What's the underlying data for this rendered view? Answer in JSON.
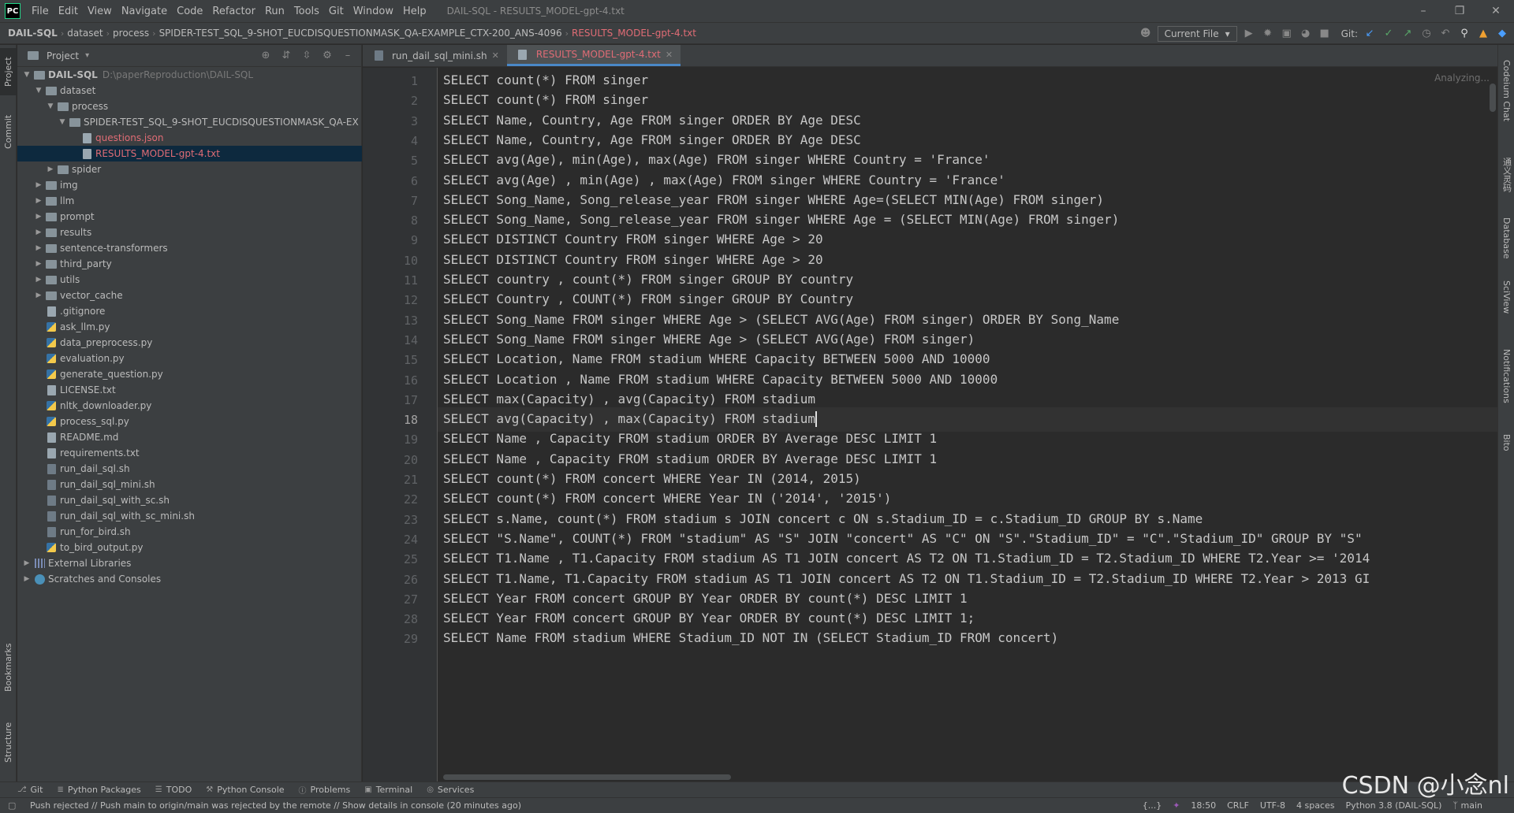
{
  "app": {
    "logo": "PC",
    "window_title": "DAIL-SQL - RESULTS_MODEL-gpt-4.txt",
    "menu": [
      "File",
      "Edit",
      "View",
      "Navigate",
      "Code",
      "Refactor",
      "Run",
      "Tools",
      "Git",
      "Window",
      "Help"
    ]
  },
  "navbar": {
    "breadcrumbs": [
      "DAIL-SQL",
      "dataset",
      "process",
      "SPIDER-TEST_SQL_9-SHOT_EUCDISQUESTIONMASK_QA-EXAMPLE_CTX-200_ANS-4096",
      "RESULTS_MODEL-gpt-4.txt"
    ],
    "run_config": "Current File",
    "git_label": "Git:"
  },
  "left_strip": {
    "project": "Project",
    "commit": "Commit",
    "bookmarks": "Bookmarks",
    "structure": "Structure"
  },
  "right_strip": {
    "codeium": "Codeium Chat",
    "tongyi": "通义灵码",
    "database": "Database",
    "sciview": "SciView",
    "notifications": "Notifications",
    "bito": "Bito"
  },
  "project_panel": {
    "title": "Project",
    "tree": [
      {
        "depth": 0,
        "arrow": "down",
        "icon": "folder",
        "label": "DAIL-SQL",
        "extra": "D:\\paperReproduction\\DAIL-SQL",
        "bold": true
      },
      {
        "depth": 1,
        "arrow": "down",
        "icon": "folder",
        "label": "dataset"
      },
      {
        "depth": 2,
        "arrow": "down",
        "icon": "folder",
        "label": "process"
      },
      {
        "depth": 3,
        "arrow": "down",
        "icon": "folder",
        "label": "SPIDER-TEST_SQL_9-SHOT_EUCDISQUESTIONMASK_QA-EX"
      },
      {
        "depth": 4,
        "arrow": "",
        "icon": "file",
        "label": "questions.json",
        "red": true
      },
      {
        "depth": 4,
        "arrow": "",
        "icon": "file",
        "label": "RESULTS_MODEL-gpt-4.txt",
        "red": true,
        "selected": true
      },
      {
        "depth": 2,
        "arrow": "right",
        "icon": "folder",
        "label": "spider"
      },
      {
        "depth": 1,
        "arrow": "right",
        "icon": "folder",
        "label": "img"
      },
      {
        "depth": 1,
        "arrow": "right",
        "icon": "folder",
        "label": "llm"
      },
      {
        "depth": 1,
        "arrow": "right",
        "icon": "folder",
        "label": "prompt"
      },
      {
        "depth": 1,
        "arrow": "right",
        "icon": "folder",
        "label": "results"
      },
      {
        "depth": 1,
        "arrow": "right",
        "icon": "folder",
        "label": "sentence-transformers"
      },
      {
        "depth": 1,
        "arrow": "right",
        "icon": "folder",
        "label": "third_party"
      },
      {
        "depth": 1,
        "arrow": "right",
        "icon": "folder",
        "label": "utils"
      },
      {
        "depth": 1,
        "arrow": "right",
        "icon": "folder",
        "label": "vector_cache"
      },
      {
        "depth": 1,
        "arrow": "",
        "icon": "file",
        "label": ".gitignore"
      },
      {
        "depth": 1,
        "arrow": "",
        "icon": "py",
        "label": "ask_llm.py"
      },
      {
        "depth": 1,
        "arrow": "",
        "icon": "py",
        "label": "data_preprocess.py"
      },
      {
        "depth": 1,
        "arrow": "",
        "icon": "py",
        "label": "evaluation.py"
      },
      {
        "depth": 1,
        "arrow": "",
        "icon": "py",
        "label": "generate_question.py"
      },
      {
        "depth": 1,
        "arrow": "",
        "icon": "file",
        "label": "LICENSE.txt"
      },
      {
        "depth": 1,
        "arrow": "",
        "icon": "py",
        "label": "nltk_downloader.py"
      },
      {
        "depth": 1,
        "arrow": "",
        "icon": "py",
        "label": "process_sql.py"
      },
      {
        "depth": 1,
        "arrow": "",
        "icon": "file",
        "label": "README.md"
      },
      {
        "depth": 1,
        "arrow": "",
        "icon": "file",
        "label": "requirements.txt"
      },
      {
        "depth": 1,
        "arrow": "",
        "icon": "sh",
        "label": "run_dail_sql.sh"
      },
      {
        "depth": 1,
        "arrow": "",
        "icon": "sh",
        "label": "run_dail_sql_mini.sh"
      },
      {
        "depth": 1,
        "arrow": "",
        "icon": "sh",
        "label": "run_dail_sql_with_sc.sh"
      },
      {
        "depth": 1,
        "arrow": "",
        "icon": "sh",
        "label": "run_dail_sql_with_sc_mini.sh"
      },
      {
        "depth": 1,
        "arrow": "",
        "icon": "sh",
        "label": "run_for_bird.sh"
      },
      {
        "depth": 1,
        "arrow": "",
        "icon": "py",
        "label": "to_bird_output.py"
      },
      {
        "depth": 0,
        "arrow": "right",
        "icon": "lib",
        "label": "External Libraries"
      },
      {
        "depth": 0,
        "arrow": "right",
        "icon": "scratch",
        "label": "Scratches and Consoles"
      }
    ]
  },
  "editor": {
    "tabs": [
      {
        "label": "run_dail_sql_mini.sh",
        "active": false
      },
      {
        "label": "RESULTS_MODEL-gpt-4.txt",
        "active": true
      }
    ],
    "status_hint": "Analyzing...",
    "current_line": 18,
    "lines": [
      "SELECT count(*) FROM singer",
      "SELECT count(*) FROM singer",
      "SELECT Name, Country, Age FROM singer ORDER BY Age DESC",
      "SELECT Name, Country, Age FROM singer ORDER BY Age DESC",
      "SELECT avg(Age), min(Age), max(Age) FROM singer WHERE Country = 'France'",
      "SELECT avg(Age) , min(Age) , max(Age) FROM singer WHERE Country = 'France'",
      "SELECT Song_Name, Song_release_year FROM singer WHERE Age=(SELECT MIN(Age) FROM singer)",
      "SELECT Song_Name, Song_release_year FROM singer WHERE Age = (SELECT MIN(Age) FROM singer)",
      "SELECT DISTINCT Country FROM singer WHERE Age > 20",
      "SELECT DISTINCT Country FROM singer WHERE Age > 20",
      "SELECT country , count(*) FROM singer GROUP BY country",
      "SELECT Country , COUNT(*) FROM singer GROUP BY Country",
      "SELECT Song_Name FROM singer WHERE Age > (SELECT AVG(Age) FROM singer) ORDER BY Song_Name",
      "SELECT Song_Name FROM singer WHERE Age > (SELECT AVG(Age) FROM singer)",
      "SELECT Location, Name FROM stadium WHERE Capacity BETWEEN 5000 AND 10000",
      "SELECT Location , Name FROM stadium WHERE Capacity BETWEEN 5000 AND 10000",
      "SELECT max(Capacity) , avg(Capacity) FROM stadium",
      "SELECT avg(Capacity) , max(Capacity) FROM stadium",
      "SELECT Name , Capacity FROM stadium ORDER BY Average DESC LIMIT 1",
      "SELECT Name , Capacity FROM stadium ORDER BY Average DESC LIMIT 1",
      "SELECT count(*) FROM concert WHERE Year IN (2014, 2015)",
      "SELECT count(*) FROM concert WHERE Year IN ('2014', '2015')",
      "SELECT s.Name, count(*) FROM stadium s JOIN concert c ON s.Stadium_ID = c.Stadium_ID GROUP BY s.Name",
      "SELECT \"S.Name\", COUNT(*) FROM \"stadium\" AS \"S\" JOIN \"concert\" AS \"C\" ON \"S\".\"Stadium_ID\" = \"C\".\"Stadium_ID\" GROUP BY \"S\"",
      "SELECT T1.Name , T1.Capacity FROM stadium AS T1 JOIN concert AS T2 ON T1.Stadium_ID = T2.Stadium_ID WHERE T2.Year >= '2014",
      "SELECT T1.Name, T1.Capacity FROM stadium AS T1 JOIN concert AS T2 ON T1.Stadium_ID = T2.Stadium_ID WHERE T2.Year > 2013 GI",
      "SELECT Year FROM concert GROUP BY Year ORDER BY count(*) DESC LIMIT 1",
      "SELECT Year FROM concert GROUP BY Year ORDER BY count(*) DESC LIMIT 1;",
      "SELECT Name FROM stadium WHERE Stadium_ID NOT IN (SELECT Stadium_ID FROM concert)"
    ]
  },
  "bottom_tabs": [
    "Git",
    "Python Packages",
    "TODO",
    "Python Console",
    "Problems",
    "Terminal",
    "Services"
  ],
  "statusbar": {
    "message": "Push rejected // Push main to origin/main was rejected by the remote // Show details in console (20 minutes ago)",
    "braces": "{...}",
    "position": "18:50",
    "line_sep": "CRLF",
    "encoding": "UTF-8",
    "indent": "4 spaces",
    "interpreter": "Python 3.8 (DAIL-SQL)",
    "branch": "main"
  },
  "watermark": "CSDN @小念nl"
}
